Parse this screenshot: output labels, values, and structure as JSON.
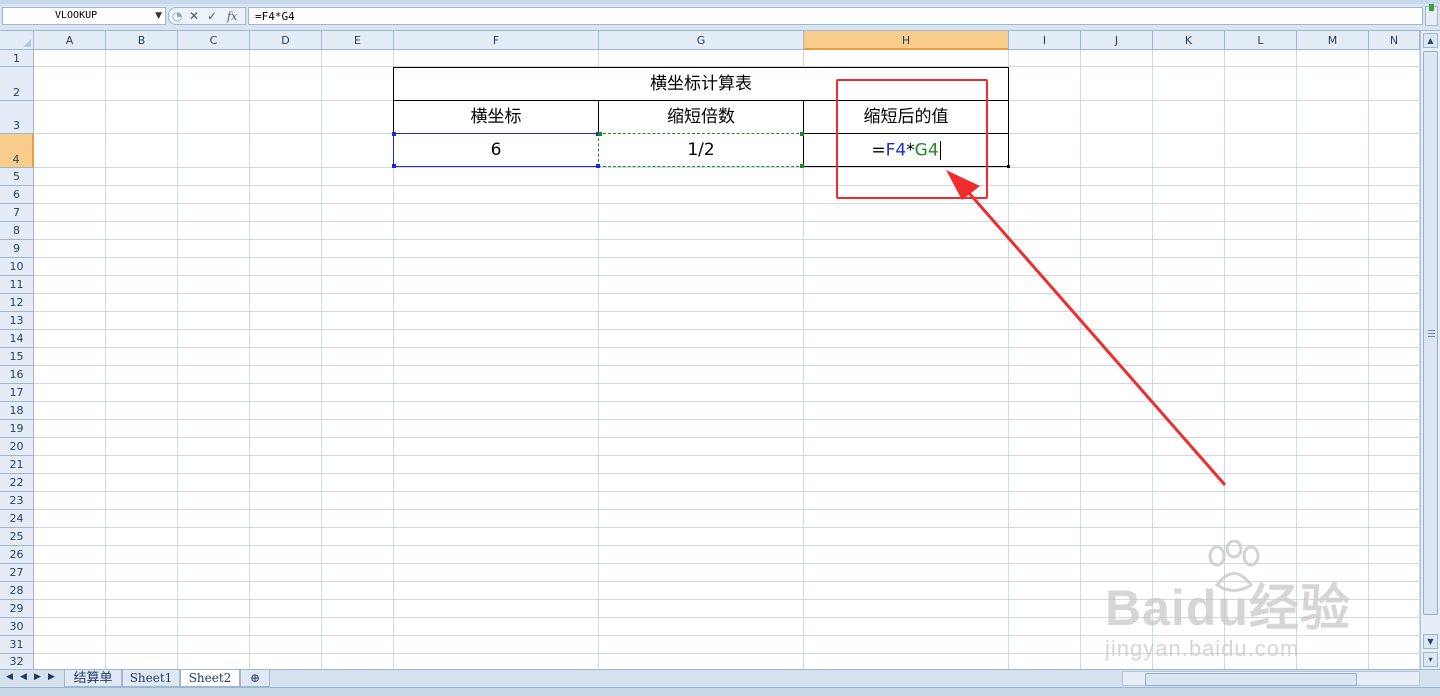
{
  "formula_bar": {
    "name_box": "VLOOKUP",
    "cancel_symbol": "✕",
    "enter_symbol": "✓",
    "fx_label": "fx",
    "formula": "=F4*G4"
  },
  "columns": [
    "A",
    "B",
    "C",
    "D",
    "E",
    "F",
    "G",
    "H",
    "I",
    "J",
    "K",
    "L",
    "M",
    "N"
  ],
  "selected_column": "H",
  "rows": [
    "1",
    "2",
    "3",
    "4",
    "5",
    "6",
    "7",
    "8",
    "9",
    "10",
    "11",
    "12",
    "13",
    "14",
    "15",
    "16",
    "17",
    "18",
    "19",
    "20",
    "21",
    "22",
    "23",
    "24",
    "25",
    "26",
    "27",
    "28",
    "29",
    "30",
    "31",
    "32"
  ],
  "selected_row": "4",
  "table": {
    "title": "横坐标计算表",
    "headers": [
      "横坐标",
      "缩短倍数",
      "缩短后的值"
    ],
    "row": {
      "f4": "6",
      "g4": "1/2",
      "h4_eq": "=",
      "h4_ref1": "F4",
      "h4_op": "*",
      "h4_ref2": "G4"
    }
  },
  "sheet_tabs": [
    "结算单",
    "Sheet1",
    "Sheet2"
  ],
  "active_sheet": "Sheet2",
  "watermark": {
    "logo": "Baidu经验",
    "url": "jingyan.baidu.com"
  },
  "colors": {
    "ref_blue": "#1a2bd6",
    "ref_green": "#208a20",
    "annotation_red": "#f02c2c",
    "header_selected": "#f8cd8b"
  }
}
